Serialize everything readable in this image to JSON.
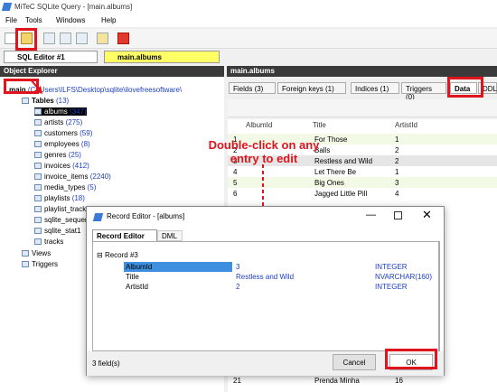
{
  "window": {
    "title": "MiTeC SQLite Query - [main.albums]"
  },
  "menu": {
    "items": [
      "File",
      "Tools",
      "Windows",
      "Help"
    ]
  },
  "doc_tabs": [
    "SQL Editor #1",
    "main.albums"
  ],
  "object_explorer": {
    "header": "Object Explorer",
    "db_name": "main",
    "db_path": "(C:\\Users\\ILFS\\Desktop\\sqlite\\ilovefreesoftware\\",
    "tables_label": "Tables",
    "tables_count": "(13)",
    "tables": [
      {
        "name": "albums",
        "count": "(347)"
      },
      {
        "name": "artists",
        "count": "(275)"
      },
      {
        "name": "customers",
        "count": "(59)"
      },
      {
        "name": "employees",
        "count": "(8)"
      },
      {
        "name": "genres",
        "count": "(25)"
      },
      {
        "name": "invoices",
        "count": "(412)"
      },
      {
        "name": "invoice_items",
        "count": "(2240)"
      },
      {
        "name": "media_types",
        "count": "(5)"
      },
      {
        "name": "playlists",
        "count": "(18)"
      },
      {
        "name": "playlist_track",
        "count": "(8715)"
      },
      {
        "name": "sqlite_sequence",
        "count": ""
      },
      {
        "name": "sqlite_stat1",
        "count": ""
      },
      {
        "name": "tracks",
        "count": ""
      }
    ],
    "views_label": "Views",
    "triggers_label": "Triggers"
  },
  "main_pane": {
    "header": "main.albums",
    "tabs": [
      "Fields (3)",
      "Foreign keys (1)",
      "Indices (1)",
      "Triggers (0)",
      "Data",
      "DDL"
    ],
    "columns": [
      "AlbumId",
      "Title",
      "ArtistId"
    ],
    "rows": [
      [
        "1",
        "For Those",
        "1"
      ],
      [
        "2",
        "Balls",
        "2"
      ],
      [
        "3",
        "Restless and Wild",
        "2"
      ],
      [
        "4",
        "Let There Be",
        "1"
      ],
      [
        "5",
        "Big Ones",
        "3"
      ],
      [
        "6",
        "Jagged Little Pill",
        "4"
      ]
    ],
    "bottom_row": [
      "21",
      "Prenda Minha",
      "16"
    ]
  },
  "annotation": {
    "text": "Double-click on any entry to edit"
  },
  "record_editor": {
    "title": "Record Editor - [albums]",
    "tabs": [
      "Record Editor",
      "DML"
    ],
    "record_label": "Record #3",
    "fields": [
      {
        "name": "AlbumId",
        "value": "3",
        "type": "INTEGER"
      },
      {
        "name": "Title",
        "value": "Restless and Wild",
        "type": "NVARCHAR(160)"
      },
      {
        "name": "ArtistId",
        "value": "2",
        "type": "INTEGER"
      }
    ],
    "status": "3 field(s)",
    "cancel_label": "Cancel",
    "ok_label": "OK"
  }
}
